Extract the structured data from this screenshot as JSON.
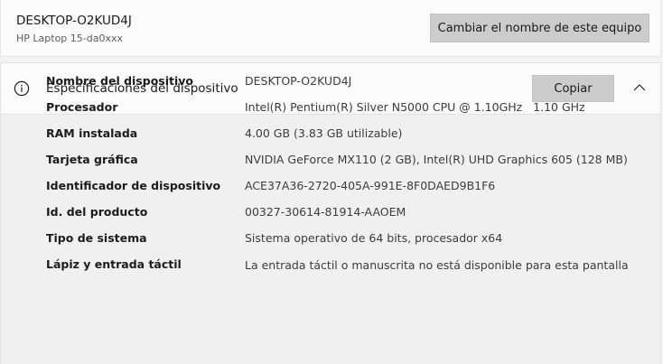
{
  "device": {
    "name": "DESKTOP-O2KUD4J",
    "model": "HP Laptop 15-da0xxx",
    "rename_label": "Cambiar el nombre de este equipo"
  },
  "specs": {
    "title": "Especificaciones del dispositivo",
    "copy_label": "Copiar",
    "rows": [
      {
        "label": "Nombre del dispositivo",
        "value": "DESKTOP-O2KUD4J"
      },
      {
        "label": "Procesador",
        "value": "Intel(R) Pentium(R) Silver N5000 CPU @ 1.10GHz   1.10 GHz"
      },
      {
        "label": "RAM instalada",
        "value": "4.00 GB (3.83 GB utilizable)"
      },
      {
        "label": "Tarjeta gráfica",
        "value": "NVIDIA GeForce MX110 (2 GB), Intel(R) UHD Graphics 605 (128 MB)"
      },
      {
        "label": "Identificador de dispositivo",
        "value": "ACE37A36-2720-405A-991E-8F0DAED9B1F6"
      },
      {
        "label": "Id. del producto",
        "value": "00327-30614-81914-AAOEM"
      },
      {
        "label": "Tipo de sistema",
        "value": "Sistema operativo de 64 bits, procesador x64"
      },
      {
        "label": "Lápiz y entrada táctil",
        "value": "La entrada táctil o manuscrita no está disponible para esta pantalla"
      }
    ]
  },
  "icons": {
    "info": "info-icon",
    "chevron": "chevron-up-icon"
  }
}
